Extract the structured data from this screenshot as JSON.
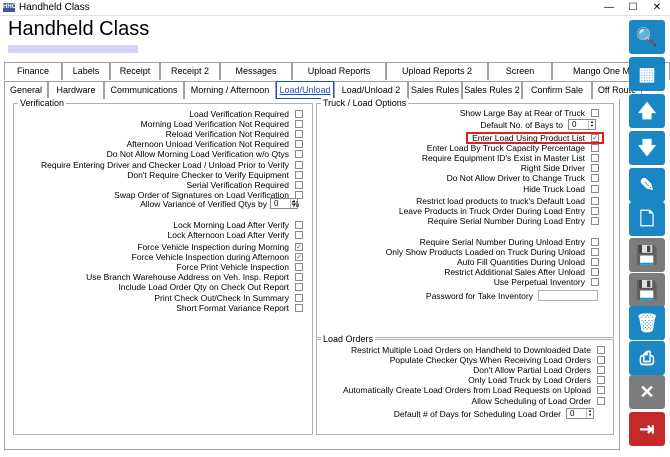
{
  "window": {
    "title": "Handheld Class",
    "icon_label": "HHC"
  },
  "header": {
    "title": "Handheld Class"
  },
  "tabs_row1": [
    "Finance",
    "Labels",
    "Receipt",
    "Receipt 2",
    "Messages",
    "Upload Reports",
    "Upload Reports 2",
    "Screen",
    "Mango One Mobile"
  ],
  "tabs_row2": [
    "General",
    "Hardware",
    "Communications",
    "Morning / Afternoon",
    "Load/Unload",
    "Load/Unload 2",
    "Sales Rules",
    "Sales Rules 2",
    "Confirm Sale",
    "Off Route"
  ],
  "active_tab": "Load/Unload",
  "verification": {
    "title": "Verification",
    "rows": [
      {
        "label": "Load Verification Required",
        "checked": false
      },
      {
        "label": "Morning Load Verification Not Required",
        "checked": false
      },
      {
        "label": "Reload Verification Not Required",
        "checked": false
      },
      {
        "label": "Afternoon Unload Verification Not Required",
        "checked": false
      },
      {
        "label": "Do Not Allow Morning Load Verification w/o Qtys",
        "checked": false
      },
      {
        "label": "Require Entering Driver and Checker Load / Unload Prior to Verify",
        "checked": false
      },
      {
        "label": "Don't Require Checker to Verify Equipment",
        "checked": false
      },
      {
        "label": "Serial Verification Required",
        "checked": false
      },
      {
        "label": "Swap Order of Signatures on Load Verification",
        "checked": false
      }
    ],
    "variance_label": "Allow Variance of Verified Qtys by",
    "variance_value": "0",
    "variance_unit": "%",
    "rows2": [
      {
        "label": "Lock Morning Load After Verify",
        "checked": false
      },
      {
        "label": "Lock Afternoon Load After Verify",
        "checked": false
      }
    ],
    "rows3": [
      {
        "label": "Force Vehicle Inspection during Morning",
        "checked": true
      },
      {
        "label": "Force Vehicle Inspection during Afternoon",
        "checked": true
      },
      {
        "label": "Force Print Vehicle Inspection",
        "checked": false
      },
      {
        "label": "Use Branch Warehouse Address on Veh. Insp. Report",
        "checked": false
      },
      {
        "label": "Include Load Order Qty on Check Out Report",
        "checked": false
      },
      {
        "label": "Print Check Out/Check In Summary",
        "checked": false
      },
      {
        "label": "Short Format Variance Report",
        "checked": false
      }
    ]
  },
  "truck_load": {
    "title": "Truck / Load Options",
    "show_bay_label": "Show Large Bay at Rear of Truck",
    "default_bays_label": "Default No. of Bays to",
    "default_bays_value": "0",
    "rows": [
      {
        "label": "Enter Load Using Product List",
        "checked": true
      },
      {
        "label": "Enter Load By Truck Capacity Percentage",
        "checked": false
      },
      {
        "label": "Require Equipment ID's Exist in Master List",
        "checked": false
      },
      {
        "label": "Right Side Driver",
        "checked": false
      },
      {
        "label": "Do Not Allow Driver to Change Truck",
        "checked": false
      },
      {
        "label": "Hide Truck Load",
        "checked": false
      }
    ],
    "rows2": [
      {
        "label": "Restrict load products to truck's Default Load",
        "checked": false
      },
      {
        "label": "Leave Products in Truck Order During Load Entry",
        "checked": false
      },
      {
        "label": "Require Serial Number During Load Entry",
        "checked": false
      }
    ],
    "rows3": [
      {
        "label": "Require Serial Number During Unload Entry",
        "checked": false
      },
      {
        "label": "Only Show Products Loaded on Truck During Unload",
        "checked": false
      },
      {
        "label": "Auto Fill Quantities During Unload",
        "checked": false
      },
      {
        "label": "Restrict Additional Sales After Unload",
        "checked": false
      },
      {
        "label": "Use Perpetual Inventory",
        "checked": false
      }
    ],
    "password_label": "Password for Take Inventory"
  },
  "load_orders": {
    "title": "Load Orders",
    "rows": [
      {
        "label": "Restrict Multiple Load Orders on Handheld to Downloaded Date",
        "checked": false
      },
      {
        "label": "Populate Checker Qtys When Receiving Load Orders",
        "checked": false
      },
      {
        "label": "Don't Allow Partial Load Orders",
        "checked": false
      },
      {
        "label": "Only Load Truck by Load Orders",
        "checked": false
      },
      {
        "label": "Automatically Create Load Orders from Load Requests on Upload",
        "checked": false
      },
      {
        "label": "Allow Scheduling of Load Order",
        "checked": false
      }
    ],
    "days_label": "Default # of Days for Scheduling Load Order",
    "days_value": "0"
  },
  "toolbar": [
    {
      "icon": "search-icon",
      "glyph": "🔍",
      "color": "blue"
    },
    {
      "icon": "grid-icon",
      "glyph": "▦",
      "color": "blue"
    },
    {
      "icon": "arrow-up-icon",
      "glyph": "🡅",
      "color": "blue"
    },
    {
      "icon": "arrow-down-icon",
      "glyph": "🡇",
      "color": "blue"
    },
    {
      "icon": "pencil-icon",
      "glyph": "✎",
      "color": "blue"
    },
    {
      "icon": "new-document-icon",
      "glyph": "🗋",
      "color": "blue"
    },
    {
      "icon": "save-copy-icon",
      "glyph": "💾",
      "color": "gray"
    },
    {
      "icon": "save-icon",
      "glyph": "💾",
      "color": "gray"
    },
    {
      "icon": "trash-icon",
      "glyph": "🗑",
      "color": "blue"
    },
    {
      "icon": "print-icon",
      "glyph": "⎙",
      "color": "blue"
    },
    {
      "icon": "close-x-icon",
      "glyph": "✕",
      "color": "gray"
    },
    {
      "icon": "exit-door-icon",
      "glyph": "⇥",
      "color": "red"
    }
  ]
}
